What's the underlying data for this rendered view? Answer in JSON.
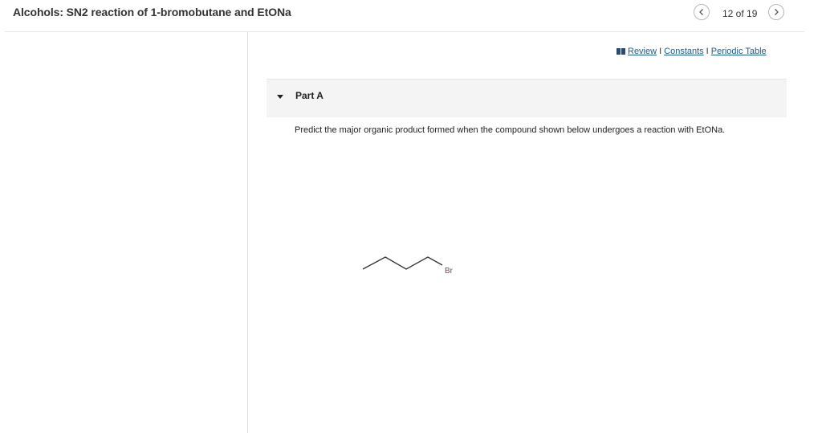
{
  "header": {
    "title": "Alcohols: SN2 reaction of 1-bromobutane and EtONa",
    "pager": "12 of 19",
    "prev_icon": "chevron-left-icon",
    "next_icon": "chevron-right-icon"
  },
  "resources": {
    "icon": "book-icon",
    "review": "Review",
    "separator": "I",
    "constants": "Constants",
    "periodic_table": "Periodic Table"
  },
  "part": {
    "caret_icon": "caret-down-icon",
    "title": "Part A",
    "question": "Predict the major organic product formed when the compound shown below undergoes a reaction with EtONa."
  },
  "structure": {
    "atom_label": "Br",
    "atom_color": "#8b3a62",
    "bond_color": "#333333"
  }
}
